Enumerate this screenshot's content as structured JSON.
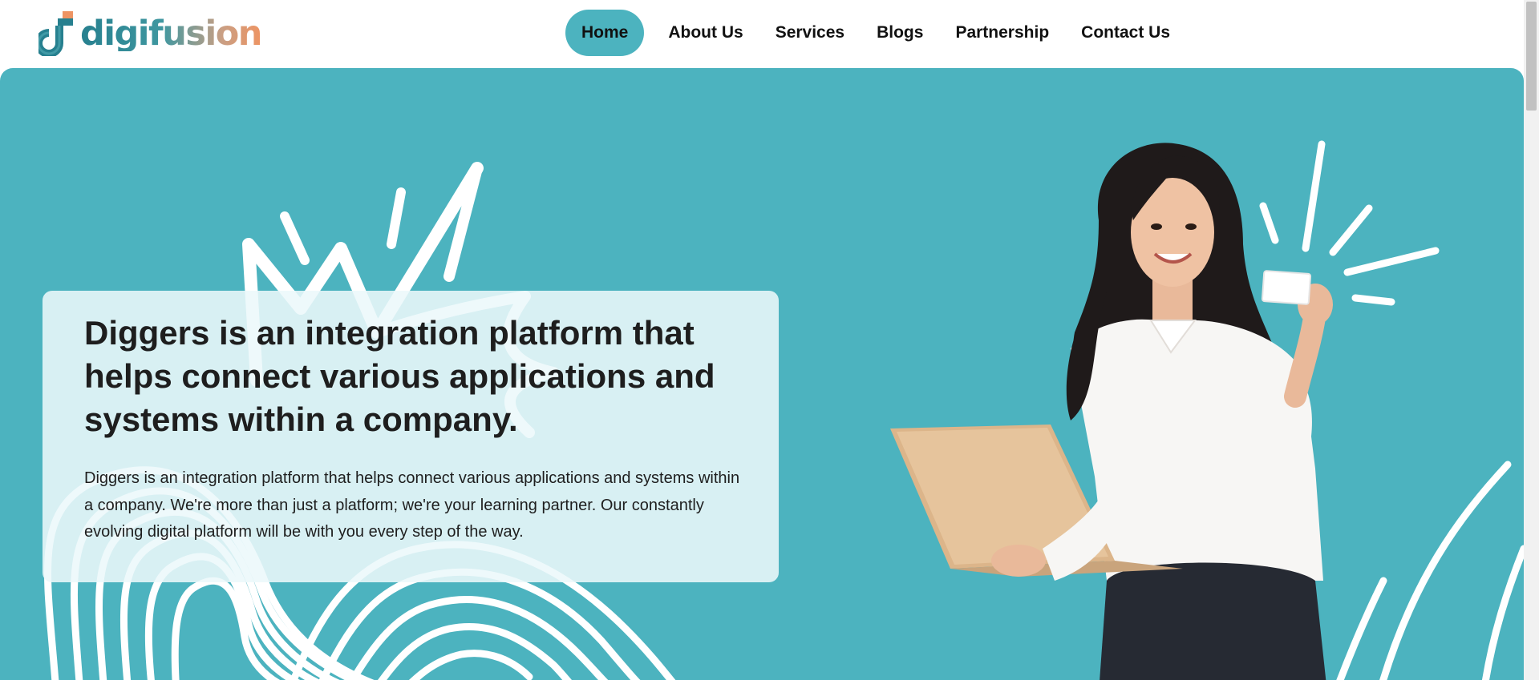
{
  "brand": {
    "name": "digifusion",
    "logo_icon": "digifusion-logo-icon"
  },
  "nav": {
    "items": [
      {
        "label": "Home",
        "active": true
      },
      {
        "label": "About Us",
        "active": false
      },
      {
        "label": "Services",
        "active": false
      },
      {
        "label": "Blogs",
        "active": false
      },
      {
        "label": "Partnership",
        "active": false
      },
      {
        "label": "Contact Us",
        "active": false
      }
    ]
  },
  "hero": {
    "title": "Diggers is an integration platform that helps connect various applications and systems within a company.",
    "text": "Diggers is an integration platform that helps connect various applications and systems within a company. We're more than just a platform; we're your learning partner. Our constantly evolving digital platform will be with you every step of the way.",
    "image": "woman-with-laptop-image"
  },
  "colors": {
    "accent": "#4cb3bf",
    "text": "#1e1e1e",
    "card_bg": "#ecf8fa",
    "logo_teal": "#27808f",
    "logo_orange": "#ee9463"
  }
}
